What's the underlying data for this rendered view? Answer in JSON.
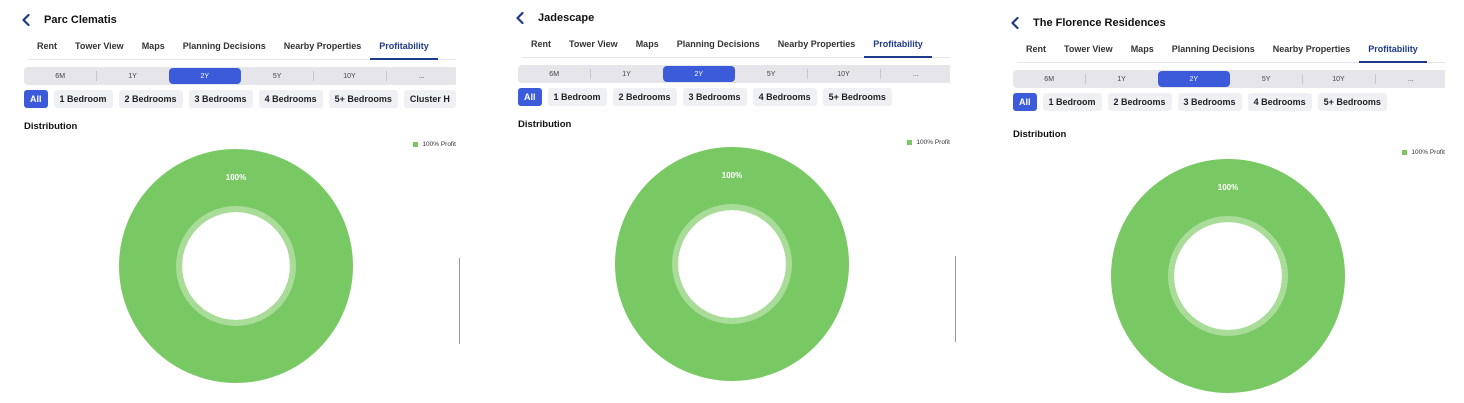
{
  "panels": [
    {
      "title": "Parc Clematis",
      "tabs": [
        "Rent",
        "Tower View",
        "Maps",
        "Planning Decisions",
        "Nearby Properties",
        "Profitability"
      ],
      "active_tab": 5,
      "periods": [
        "6M",
        "1Y",
        "2Y",
        "5Y",
        "10Y",
        "..."
      ],
      "active_period": 2,
      "bedrooms": [
        "All",
        "1 Bedroom",
        "2 Bedrooms",
        "3 Bedrooms",
        "4 Bedrooms",
        "5+ Bedrooms",
        "Cluster H"
      ],
      "section_title": "Distribution",
      "chart_data": {
        "type": "pie",
        "categories": [
          "100% Profit"
        ],
        "values": [
          100
        ],
        "data_labels": [
          "100%"
        ],
        "legend": "top-right",
        "colors": [
          "#78c864"
        ]
      }
    },
    {
      "title": "Jadescape",
      "tabs": [
        "Rent",
        "Tower View",
        "Maps",
        "Planning Decisions",
        "Nearby Properties",
        "Profitability"
      ],
      "active_tab": 5,
      "periods": [
        "6M",
        "1Y",
        "2Y",
        "5Y",
        "10Y",
        "..."
      ],
      "active_period": 2,
      "bedrooms": [
        "All",
        "1 Bedroom",
        "2 Bedrooms",
        "3 Bedrooms",
        "4 Bedrooms",
        "5+ Bedrooms"
      ],
      "section_title": "Distribution",
      "chart_data": {
        "type": "pie",
        "categories": [
          "100% Profit"
        ],
        "values": [
          100
        ],
        "data_labels": [
          "100%"
        ],
        "legend": "top-right",
        "colors": [
          "#78c864"
        ]
      }
    },
    {
      "title": "The Florence Residences",
      "tabs": [
        "Rent",
        "Tower View",
        "Maps",
        "Planning Decisions",
        "Nearby Properties",
        "Profitability"
      ],
      "active_tab": 5,
      "periods": [
        "6M",
        "1Y",
        "2Y",
        "5Y",
        "10Y",
        "..."
      ],
      "active_period": 2,
      "bedrooms": [
        "All",
        "1 Bedroom",
        "2 Bedrooms",
        "3 Bedrooms",
        "4 Bedrooms",
        "5+ Bedrooms"
      ],
      "section_title": "Distribution",
      "chart_data": {
        "type": "pie",
        "categories": [
          "100% Profit"
        ],
        "values": [
          100
        ],
        "data_labels": [
          "100%"
        ],
        "legend": "top-right",
        "colors": [
          "#78c864"
        ]
      }
    }
  ],
  "icons": {
    "back": "chevron-left-icon"
  },
  "colors": {
    "accent": "#3b5bdb",
    "tab_active": "#1e3a8a",
    "donut_inner_ring": "#a8dc98"
  }
}
